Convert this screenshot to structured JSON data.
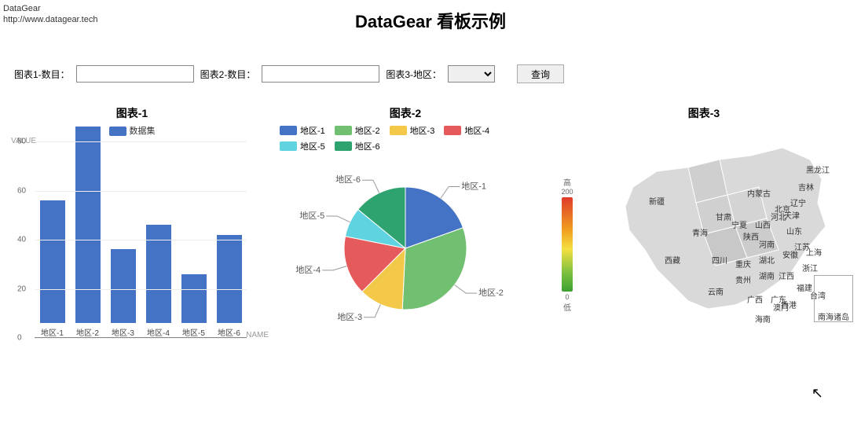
{
  "brand": {
    "name": "DataGear",
    "url": "http://www.datagear.tech"
  },
  "page_title": "DataGear 看板示例",
  "form": {
    "label1": "图表1-数目：",
    "label2": "图表2-数目：",
    "label3": "图表3-地区：",
    "input1_value": "",
    "input2_value": "",
    "select3_value": "",
    "query_button": "查询"
  },
  "chart1_title": "图表-1",
  "chart1_legend": "数据集",
  "chart2_title": "图表-2",
  "chart3_title": "图表-3",
  "visualmap": {
    "high": "高",
    "low": "低",
    "max": "200",
    "min": "0"
  },
  "inset_label": "南海诸岛",
  "map_regions": [
    "黑龙江",
    "吉林",
    "辽宁",
    "内蒙古",
    "新疆",
    "青海",
    "甘肃",
    "宁夏",
    "陕西",
    "山西",
    "河北",
    "北京",
    "天津",
    "山东",
    "河南",
    "江苏",
    "安徽",
    "上海",
    "湖北",
    "重庆",
    "四川",
    "西藏",
    "贵州",
    "湖南",
    "江西",
    "浙江",
    "福建",
    "云南",
    "广西",
    "广东",
    "台湾",
    "海南",
    "香港",
    "澳门"
  ],
  "chart_data": [
    {
      "id": "chart1",
      "type": "bar",
      "title": "图表-1",
      "xlabel": "NAME",
      "ylabel": "VALUE",
      "ylim": [
        0,
        80
      ],
      "yticks": [
        0,
        20,
        40,
        60,
        80
      ],
      "categories": [
        "地区-1",
        "地区-2",
        "地区-3",
        "地区-4",
        "地区-5",
        "地区-6"
      ],
      "series": [
        {
          "name": "数据集",
          "color": "#4472c4",
          "values": [
            50,
            80,
            30,
            40,
            20,
            36
          ]
        }
      ]
    },
    {
      "id": "chart2",
      "type": "pie",
      "title": "图表-2",
      "series": [
        {
          "name": "地区-1",
          "value": 50,
          "color": "#4472c4"
        },
        {
          "name": "地区-2",
          "value": 80,
          "color": "#71c071"
        },
        {
          "name": "地区-3",
          "value": 30,
          "color": "#f4c94a"
        },
        {
          "name": "地区-4",
          "value": 40,
          "color": "#e55a5a"
        },
        {
          "name": "地区-5",
          "value": 20,
          "color": "#5fd3e0"
        },
        {
          "name": "地区-6",
          "value": 36,
          "color": "#2fa36f"
        }
      ]
    },
    {
      "id": "chart3",
      "type": "map",
      "title": "图表-3",
      "region": "china",
      "visual_range": [
        0,
        200
      ],
      "visual_labels": {
        "high": "高",
        "low": "低"
      }
    }
  ]
}
